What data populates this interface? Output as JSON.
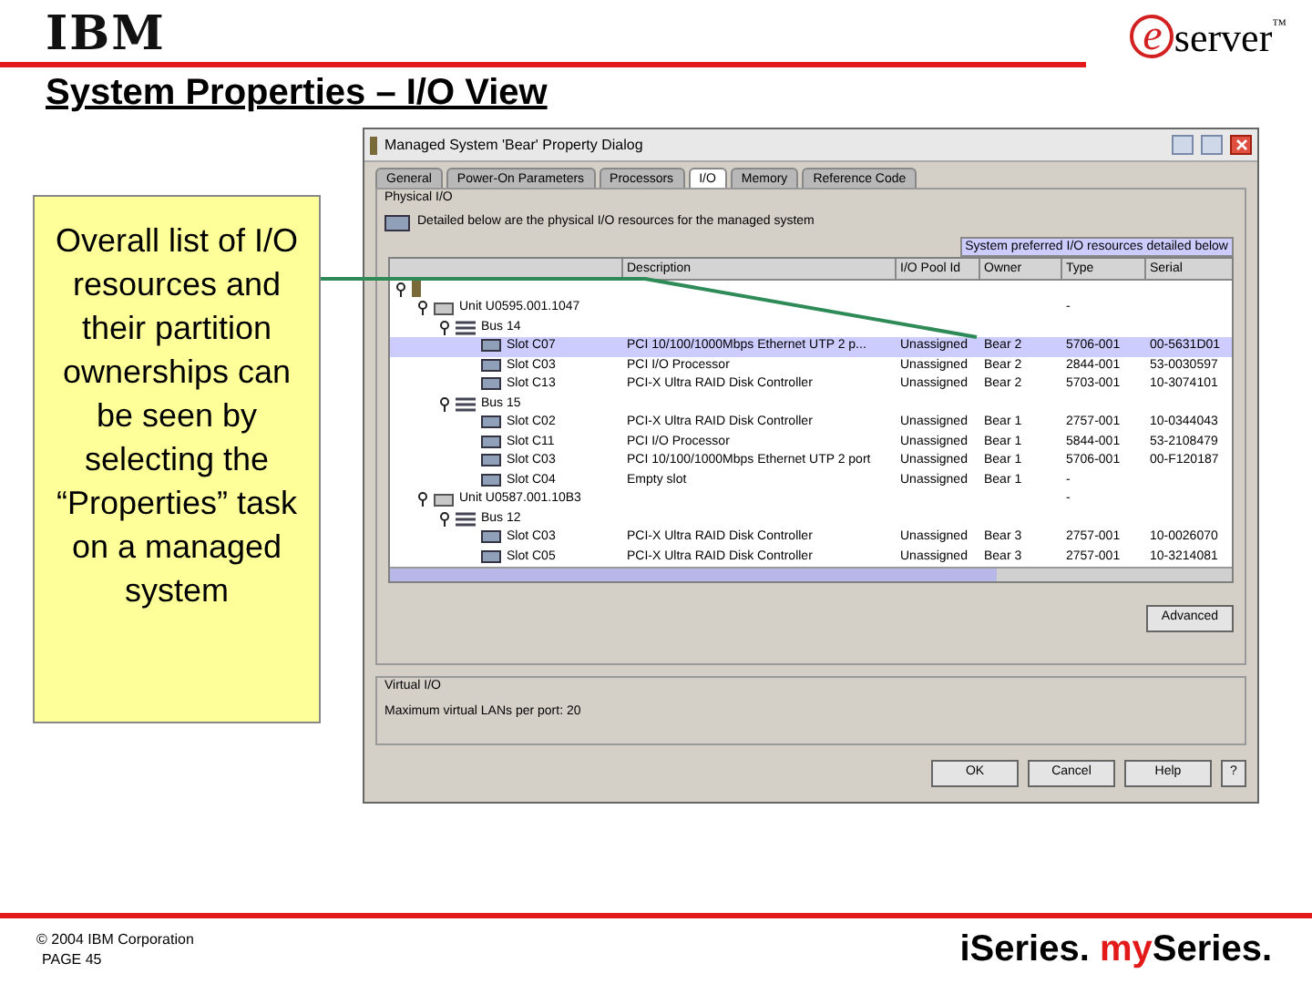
{
  "slide": {
    "logo": "IBM",
    "brand": {
      "letter": "e",
      "word": "server",
      "mark": "™"
    },
    "title": "System Properties – I/O View",
    "callout": "Overall list of I/O resources and their partition ownerships can be seen by selecting the “Properties” task on a managed system",
    "footer": {
      "copyright_mark": "©",
      "copyright": "2004 IBM Corporation",
      "page": "PAGE 45",
      "tagline": [
        {
          "text": "iSeries.",
          "color": "#000000"
        },
        {
          "text": "my",
          "color": "#e21a1a"
        },
        {
          "text": "Series.",
          "color": "#000000"
        }
      ]
    }
  },
  "dialog": {
    "title": "Managed System 'Bear' Property Dialog",
    "tabs": [
      {
        "label": "General",
        "selected": false
      },
      {
        "label": "Power-On Parameters",
        "selected": false
      },
      {
        "label": "Processors",
        "selected": false
      },
      {
        "label": "I/O",
        "selected": true
      },
      {
        "label": "Memory",
        "selected": false
      },
      {
        "label": "Reference Code",
        "selected": false
      }
    ],
    "physical_io": {
      "legend": "Physical I/O",
      "description": "Detailed below are the physical I/O resources for the managed system",
      "note": "System preferred I/O resources detailed below",
      "table": {
        "columns": [
          "Description",
          "I/O Pool Id",
          "Owner",
          "Type",
          "Serial"
        ],
        "tree": [
          {
            "kind": "system",
            "expanded": true,
            "selected": false,
            "children": [
              {
                "kind": "unit",
                "label": "Unit U0595.001.1047",
                "type": "-",
                "expanded": true,
                "selected": false,
                "children": [
                  {
                    "kind": "bus",
                    "label": "Bus 14",
                    "expanded": true,
                    "selected": false,
                    "children": [
                      {
                        "kind": "slot",
                        "label": "Slot C07",
                        "description": "PCI 10/100/1000Mbps Ethernet UTP 2 p...",
                        "pool": "Unassigned",
                        "owner": "Bear 2",
                        "type": "5706-001",
                        "serial": "00-5631D01",
                        "selected": true
                      },
                      {
                        "kind": "slot",
                        "label": "Slot C03",
                        "description": "PCI I/O Processor",
                        "pool": "Unassigned",
                        "owner": "Bear 2",
                        "type": "2844-001",
                        "serial": "53-0030597",
                        "selected": false
                      },
                      {
                        "kind": "slot",
                        "label": "Slot C13",
                        "description": "PCI-X Ultra RAID Disk Controller",
                        "pool": "Unassigned",
                        "owner": "Bear 2",
                        "type": "5703-001",
                        "serial": "10-3074101",
                        "selected": false
                      }
                    ]
                  },
                  {
                    "kind": "bus",
                    "label": "Bus 15",
                    "expanded": true,
                    "selected": false,
                    "children": [
                      {
                        "kind": "slot",
                        "label": "Slot C02",
                        "description": "PCI-X Ultra RAID Disk Controller",
                        "pool": "Unassigned",
                        "owner": "Bear 1",
                        "type": "2757-001",
                        "serial": "10-0344043",
                        "selected": false
                      },
                      {
                        "kind": "slot",
                        "label": "Slot C11",
                        "description": "PCI I/O Processor",
                        "pool": "Unassigned",
                        "owner": "Bear 1",
                        "type": "5844-001",
                        "serial": "53-2108479",
                        "selected": false
                      },
                      {
                        "kind": "slot",
                        "label": "Slot C03",
                        "description": "PCI 10/100/1000Mbps Ethernet UTP 2 port",
                        "pool": "Unassigned",
                        "owner": "Bear 1",
                        "type": "5706-001",
                        "serial": "00-F120187",
                        "selected": false
                      },
                      {
                        "kind": "slot",
                        "label": "Slot C04",
                        "description": "Empty slot",
                        "pool": "Unassigned",
                        "owner": "Bear 1",
                        "type": "-",
                        "selected": false
                      }
                    ]
                  }
                ]
              },
              {
                "kind": "unit",
                "label": "Unit U0587.001.10B3",
                "type": "-",
                "expanded": true,
                "selected": false,
                "children": [
                  {
                    "kind": "bus",
                    "label": "Bus 12",
                    "expanded": true,
                    "selected": false,
                    "children": [
                      {
                        "kind": "slot",
                        "label": "Slot C03",
                        "description": "PCI-X Ultra RAID Disk Controller",
                        "pool": "Unassigned",
                        "owner": "Bear 3",
                        "type": "2757-001",
                        "serial": "10-0026070",
                        "selected": false
                      },
                      {
                        "kind": "slot",
                        "label": "Slot C05",
                        "description": "PCI-X Ultra RAID Disk Controller",
                        "pool": "Unassigned",
                        "owner": "Bear 3",
                        "type": "2757-001",
                        "serial": "10-3214081",
                        "selected": false
                      }
                    ]
                  }
                ]
              }
            ]
          }
        ]
      },
      "advanced": "Advanced"
    },
    "virtual_io": {
      "legend": "Virtual I/O",
      "text": "Maximum virtual LANs per port: 20"
    },
    "buttons": [
      "OK",
      "Cancel",
      "Help",
      "?"
    ]
  }
}
